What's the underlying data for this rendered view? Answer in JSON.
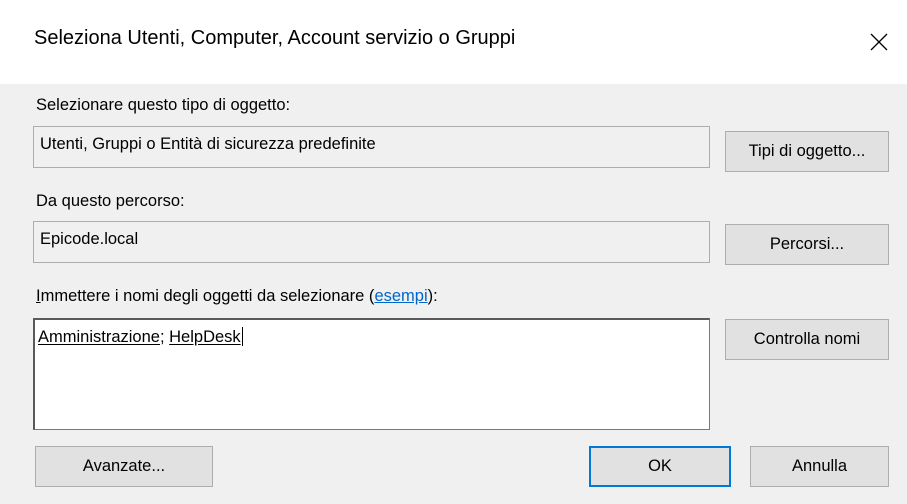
{
  "dialog": {
    "title": "Seleziona Utenti, Computer, Account servizio o Gruppi"
  },
  "object_type": {
    "label": "Selezionare questo tipo di oggetto:",
    "value": "Utenti, Gruppi o Entità di sicurezza predefinite",
    "button_label": "Tipi di oggetto..."
  },
  "location": {
    "label": "Da questo percorso:",
    "value": "Epicode.local",
    "button_label": "Percorsi..."
  },
  "names": {
    "label_first_char": "I",
    "label_rest": "mmettere i nomi degli oggetti da selezionare (",
    "examples_link": "esempi",
    "label_end": "):",
    "entries": [
      "Amministrazione",
      "HelpDesk"
    ],
    "separator": "; ",
    "check_button_label": "Controlla nomi"
  },
  "footer": {
    "advanced_label": "Avanzate...",
    "ok_label": "OK",
    "cancel_label": "Annulla"
  },
  "icons": {
    "close": "close-icon"
  },
  "colors": {
    "accent": "#0078d7",
    "link": "#0066cc",
    "background": "#f0f0f0",
    "button": "#e1e1e1"
  }
}
